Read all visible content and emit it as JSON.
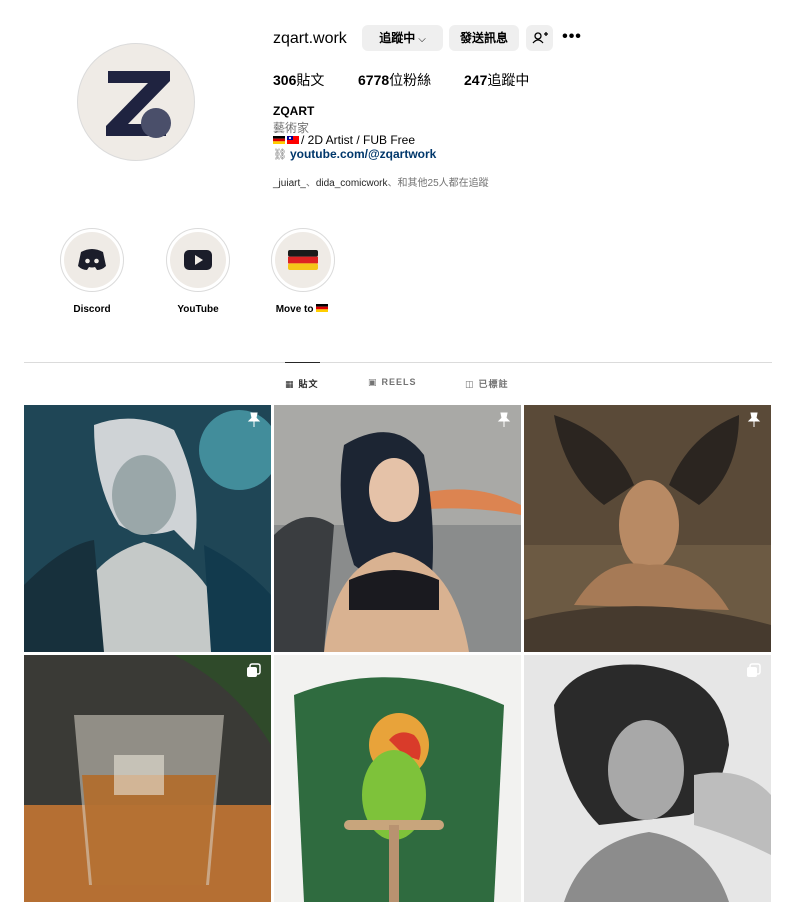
{
  "profile": {
    "username": "zqart.work",
    "follow_label": "追蹤中",
    "message_label": "發送訊息",
    "stats": {
      "posts_count": "306",
      "posts_label": "貼文",
      "followers_count": "6778",
      "followers_label": "位粉絲",
      "following_count": "247",
      "following_label": "追蹤中"
    },
    "name": "ZQART",
    "category": "藝術家",
    "bio": "/ 2D Artist / FUB Free",
    "link": "youtube.com/@zqartwork",
    "followed_by": {
      "user1": "_juiart_",
      "sep1": "、",
      "user2": "dida_comicwork",
      "rest": "、和其他25人都在追蹤"
    }
  },
  "highlights": [
    {
      "label": "Discord",
      "icon": "discord-icon"
    },
    {
      "label": "YouTube",
      "icon": "youtube-icon"
    },
    {
      "label": "Move to",
      "icon": "germany-flag-icon"
    }
  ],
  "tabs": [
    {
      "label": "貼文",
      "icon": "grid-icon",
      "active": true
    },
    {
      "label": "REELS",
      "icon": "reels-icon",
      "active": false
    },
    {
      "label": "已標註",
      "icon": "tagged-icon",
      "active": false
    }
  ],
  "posts": [
    {
      "subject": "silver-haired warrior portrait",
      "badge": "pin-icon"
    },
    {
      "subject": "winged valkyrie woman",
      "badge": "pin-icon"
    },
    {
      "subject": "winged figure on rock",
      "badge": "pin-icon"
    },
    {
      "subject": "glass of whiskey",
      "badge": "carousel-icon"
    },
    {
      "subject": "lovebird on perch",
      "badge": ""
    },
    {
      "subject": "curly-haired woman sketch",
      "badge": "carousel-icon"
    }
  ],
  "colors": {
    "accent_link": "#00376b",
    "button_bg": "#efefef",
    "logo_navy": "#1f2340"
  }
}
